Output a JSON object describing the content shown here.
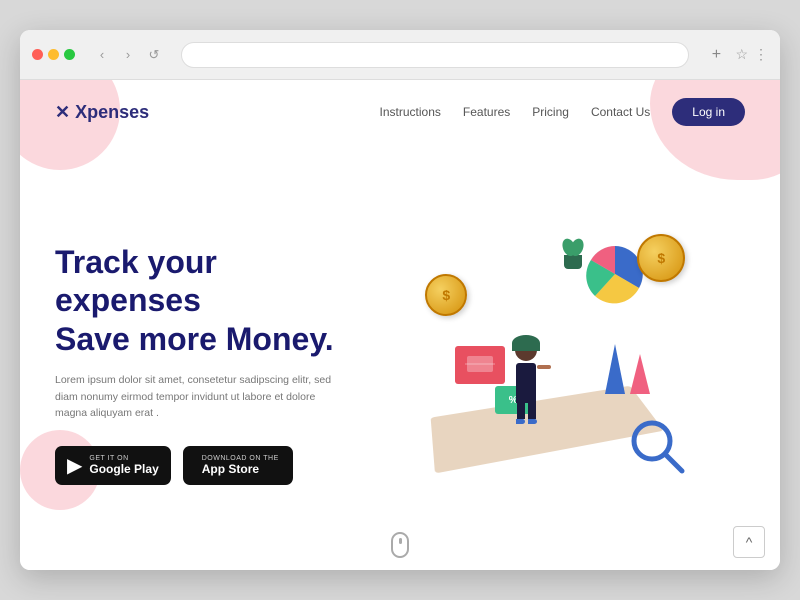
{
  "browser": {
    "new_tab_label": "+",
    "nav_back": "‹",
    "nav_forward": "›",
    "nav_refresh": "↺"
  },
  "navbar": {
    "logo": "Xpenses",
    "links": [
      {
        "label": "Instructions"
      },
      {
        "label": "Features"
      },
      {
        "label": "Pricing"
      },
      {
        "label": "Contact Us"
      }
    ],
    "login_label": "Log in"
  },
  "hero": {
    "title_line1": "Track your expenses",
    "title_line2": "Save more Money.",
    "description": "Lorem ipsum dolor sit amet, consetetur sadipscing elitr, sed diam nonumy eirmod tempor invidunt ut labore et dolore magna aliquyam erat .",
    "google_play": {
      "get_it_on": "GET IT ON",
      "store_name": "Google Play"
    },
    "app_store": {
      "download_on": "Download on the",
      "store_name": "App Store"
    }
  },
  "scroll_indicator": "scroll",
  "back_to_top": "^",
  "coin_symbol": "$",
  "percent_symbol": "%"
}
